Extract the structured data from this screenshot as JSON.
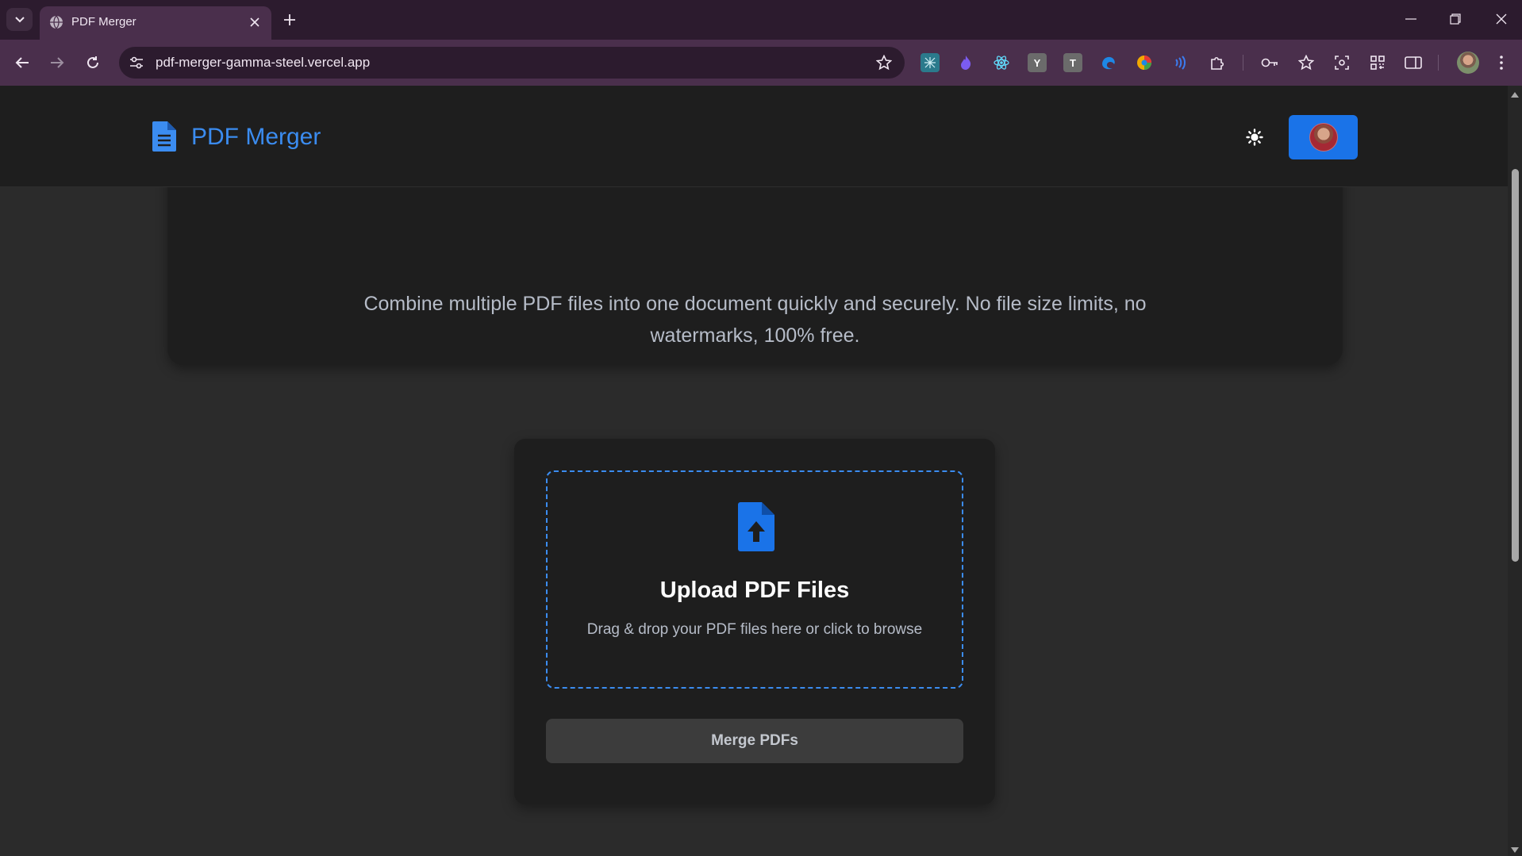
{
  "browser": {
    "tab": {
      "title": "PDF Merger",
      "favicon": "globe-icon"
    },
    "address_bar": {
      "url": "pdf-merger-gamma-steel.vercel.app"
    },
    "extensions": [
      {
        "name": "ext-grid-icon",
        "glyph": "",
        "color": "#2b7a8c"
      },
      {
        "name": "ext-flame-icon",
        "glyph": "",
        "color": "#6b4cd6"
      },
      {
        "name": "ext-react-icon",
        "glyph": "",
        "color": "#61dafb"
      },
      {
        "name": "ext-y-icon",
        "glyph": "Y",
        "color": "#6b6b6b"
      },
      {
        "name": "ext-t-icon",
        "glyph": "T",
        "color": "#6b6b6b"
      },
      {
        "name": "ext-edge-icon",
        "glyph": "",
        "color": "#1e88e5"
      },
      {
        "name": "ext-color-icon",
        "glyph": "",
        "color": "#f2a900"
      },
      {
        "name": "ext-sound-icon",
        "glyph": "",
        "color": "#3b7cf0"
      }
    ]
  },
  "header": {
    "logo_text": "PDF Merger",
    "theme_toggle": "sun-icon",
    "user": "avatar"
  },
  "hero": {
    "description": "Combine multiple PDF files into one document quickly and securely. No file size limits, no watermarks, 100% free."
  },
  "upload": {
    "title": "Upload PDF Files",
    "subtitle": "Drag & drop your PDF files here or click to browse"
  },
  "actions": {
    "merge_label": "Merge PDFs"
  },
  "colors": {
    "accent": "#3b8cf0",
    "button_blue": "#1a73e8",
    "page_bg": "#2b2b2b",
    "card_bg": "#1e1e1e",
    "chrome_tabstrip": "#2c1b2e",
    "chrome_toolbar": "#4a2f4c"
  }
}
